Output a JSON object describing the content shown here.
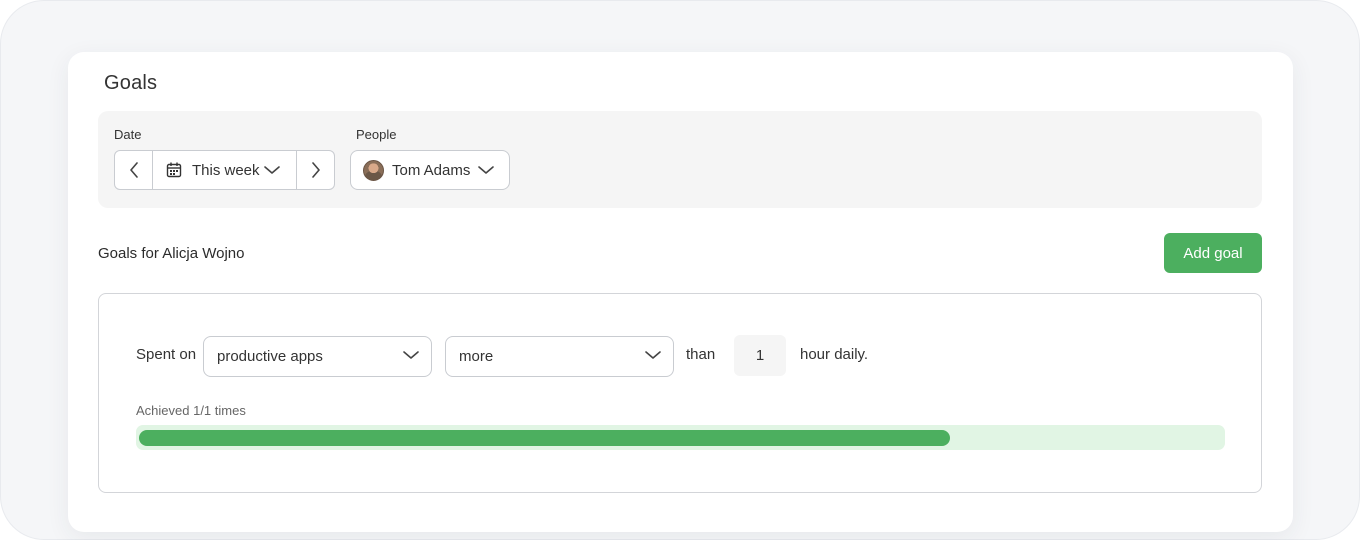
{
  "page": {
    "title": "Goals"
  },
  "filters": {
    "date_label": "Date",
    "date_value": "This week",
    "people_label": "People",
    "people_value": "Tom Adams",
    "icons": {
      "prev": "chevron-left-icon",
      "next": "chevron-right-icon",
      "calendar": "calendar-icon",
      "dropdown": "chevron-down-icon"
    }
  },
  "goals_section": {
    "title": "Goals for Alicja Wojno",
    "add_button": "Add goal"
  },
  "goal": {
    "prefix": "Spent on",
    "target_select": "productive apps",
    "comparison_select": "more",
    "than_text": "than",
    "hours_value": "1",
    "suffix": "hour daily.",
    "achieved_text": "Achieved 1/1 times",
    "progress_fraction": 0.745
  },
  "colors": {
    "accent": "#4caf5f",
    "progress_track": "#e1f5e4",
    "filter_bg": "#f5f5f5"
  }
}
